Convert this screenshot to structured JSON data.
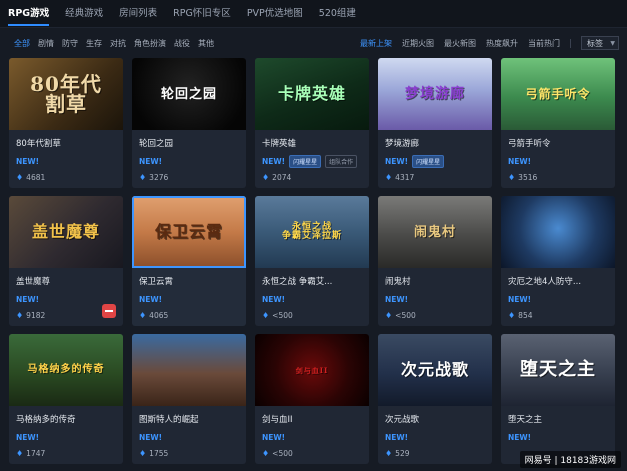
{
  "nav": {
    "tabs": [
      {
        "label": "RPG游戏",
        "active": true
      },
      {
        "label": "经典游戏",
        "active": false
      },
      {
        "label": "房间列表",
        "active": false
      },
      {
        "label": "RPG怀旧专区",
        "active": false
      },
      {
        "label": "PVP优选地图",
        "active": false
      },
      {
        "label": "520组建",
        "active": false
      }
    ]
  },
  "filters": [
    {
      "label": "全部",
      "active": true
    },
    {
      "label": "剧情",
      "active": false
    },
    {
      "label": "防守",
      "active": false
    },
    {
      "label": "生存",
      "active": false
    },
    {
      "label": "对抗",
      "active": false
    },
    {
      "label": "角色扮演",
      "active": false
    },
    {
      "label": "战役",
      "active": false
    },
    {
      "label": "其他",
      "active": false
    }
  ],
  "sort": {
    "options": [
      {
        "label": "最新上架",
        "active": true
      },
      {
        "label": "近期火图",
        "active": false
      },
      {
        "label": "最火新图",
        "active": false
      },
      {
        "label": "热度飙升",
        "active": false
      },
      {
        "label": "当前热门",
        "active": false
      }
    ],
    "dropdown": "标签"
  },
  "games": [
    {
      "name": "80年代割草",
      "art": "80年代\n割草",
      "new": "NEW!",
      "tags": [],
      "plays": "4681",
      "bg": "linear-gradient(135deg,#7a5a2c 0%,#3b2a14 60%,#1b140a 100%)",
      "title_color": "#f0d9a8",
      "title_size": 20
    },
    {
      "name": "轮回之园",
      "art": "轮回之园",
      "new": "NEW!",
      "tags": [],
      "plays": "3276",
      "bg": "radial-gradient(circle at 50% 40%,#222 0%,#050505 80%)",
      "title_color": "#ffffff",
      "title_size": 13
    },
    {
      "name": "卡牌英雄",
      "art": "卡牌英雄",
      "new": "NEW!",
      "tags": [
        {
          "label": "闪耀星星",
          "style": "blue"
        },
        {
          "label": "组队合作",
          "style": "gray"
        }
      ],
      "plays": "2074",
      "bg": "linear-gradient(160deg,#1e4a2c 0%,#0e2a18 55%,#071a0e 100%)",
      "title_color": "#a8ffb8",
      "title_size": 16
    },
    {
      "name": "梦境游廊",
      "art": "梦境游廊",
      "new": "NEW!",
      "tags": [
        {
          "label": "闪耀星星",
          "style": "blue"
        }
      ],
      "plays": "4317",
      "bg": "linear-gradient(180deg,#cfd9f0 0%,#9aa6d8 45%,#6a5aa8 100%)",
      "title_color": "#8a3fd0",
      "title_size": 14
    },
    {
      "name": "弓箭手听令",
      "art": "弓箭手听令",
      "new": "NEW!",
      "tags": [],
      "plays": "3516",
      "bg": "linear-gradient(180deg,#6fc27a 0%,#3c8a4e 55%,#2a5a36 100%)",
      "title_color": "#ffe66a",
      "title_size": 12
    },
    {
      "name": "盖世魔尊",
      "art": "盖世魔尊",
      "new": "NEW!",
      "tags": [],
      "plays": "9182",
      "gift": true,
      "bg": "linear-gradient(135deg,#5a4a3a 0%,#2f2a30 55%,#181820 100%)",
      "title_color": "#f2c24a",
      "title_size": 16
    },
    {
      "name": "保卫云霄",
      "art": "保卫云霄",
      "new": "NEW!",
      "tags": [],
      "plays": "4065",
      "highlight": true,
      "bg": "linear-gradient(180deg,#e0a070 0%,#c47a48 50%,#8a4e2a 100%)",
      "title_color": "#5a2a10",
      "title_size": 16
    },
    {
      "name": "永恒之战 争霸艾...",
      "art": "永恒之战\n争霸艾泽拉斯",
      "new": "NEW!",
      "tags": [],
      "plays": "<500",
      "bg": "linear-gradient(180deg,#5a7a9a 0%,#3a5a78 50%,#223a52 100%)",
      "title_color": "#ffd84a",
      "title_size": 9
    },
    {
      "name": "闹鬼村",
      "art": "闹鬼村",
      "new": "NEW!",
      "tags": [],
      "plays": "<500",
      "bg": "linear-gradient(180deg,#7a7a78 0%,#4a4a48 55%,#2a2a28 100%)",
      "title_color": "#e8c880",
      "title_size": 13
    },
    {
      "name": "灾厄之地4人防守...",
      "art": "",
      "new": "NEW!",
      "tags": [],
      "plays": "854",
      "bg": "radial-gradient(circle at 50% 45%,#4a8ad0 0%,#1e3a62 55%,#0c1628 100%)",
      "title_color": "#ffffff",
      "title_size": 10
    },
    {
      "name": "马格纳多的传奇",
      "art": "马格纳多的传奇",
      "new": "NEW!",
      "tags": [],
      "plays": "1747",
      "bg": "linear-gradient(180deg,#3a6a3a 0%,#2a4a22 55%,#1a2a14 100%)",
      "title_color": "#ffd24a",
      "title_size": 10
    },
    {
      "name": "图斯特人的崛起",
      "art": "",
      "new": "NEW!",
      "tags": [],
      "plays": "1755",
      "bg": "linear-gradient(180deg,#3a6aa0 0%,#6a4a3a 55%,#3a2418 100%)",
      "title_color": "#ffffff",
      "title_size": 10
    },
    {
      "name": "剑与血II",
      "art": "剑与血II",
      "new": "NEW!",
      "tags": [],
      "plays": "<500",
      "bg": "radial-gradient(circle at 50% 50%,#6a0a0a 0%,#2a0404 55%,#0a0000 100%)",
      "title_color": "#d02020",
      "title_size": 7
    },
    {
      "name": "次元战歌",
      "art": "次元战歌",
      "new": "NEW!",
      "tags": [],
      "plays": "529",
      "bg": "linear-gradient(180deg,#3a4a62 0%,#22304a 55%,#121a2a 100%)",
      "title_color": "#ffffff",
      "title_size": 16
    },
    {
      "name": "堕天之主",
      "art": "堕天之主",
      "new": "NEW!",
      "tags": [],
      "plays": "",
      "bg": "linear-gradient(180deg,#5a6272 0%,#3a4252 50%,#1e2432 100%)",
      "title_color": "#ffffff",
      "title_size": 18
    }
  ],
  "watermark": "网易号 | 18183游戏网"
}
